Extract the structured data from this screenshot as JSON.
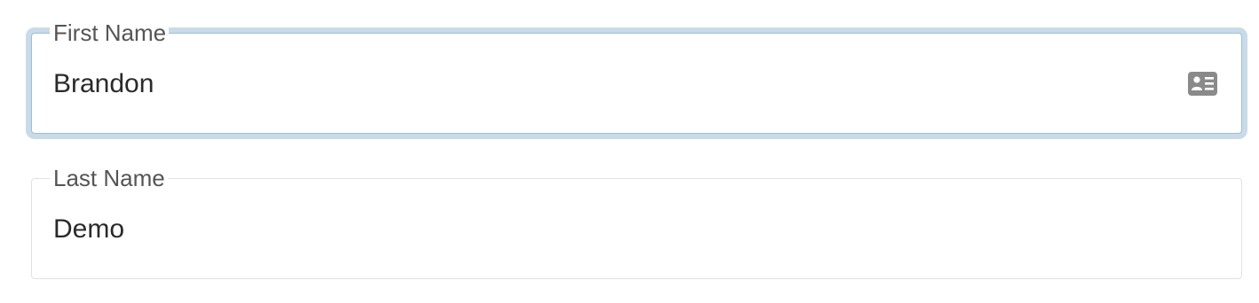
{
  "form": {
    "first_name": {
      "label": "First Name",
      "value": "Brandon",
      "icon": "contact-card-icon",
      "state": "focused"
    },
    "last_name": {
      "label": "Last Name",
      "value": "Demo"
    }
  },
  "colors": {
    "focus_border": "#9ebfd3",
    "focus_glow": "#c9dbe8",
    "default_border": "#e2e2e2",
    "label_text": "#555555",
    "value_text": "#2a2a2a",
    "icon": "#8a8a8a"
  }
}
